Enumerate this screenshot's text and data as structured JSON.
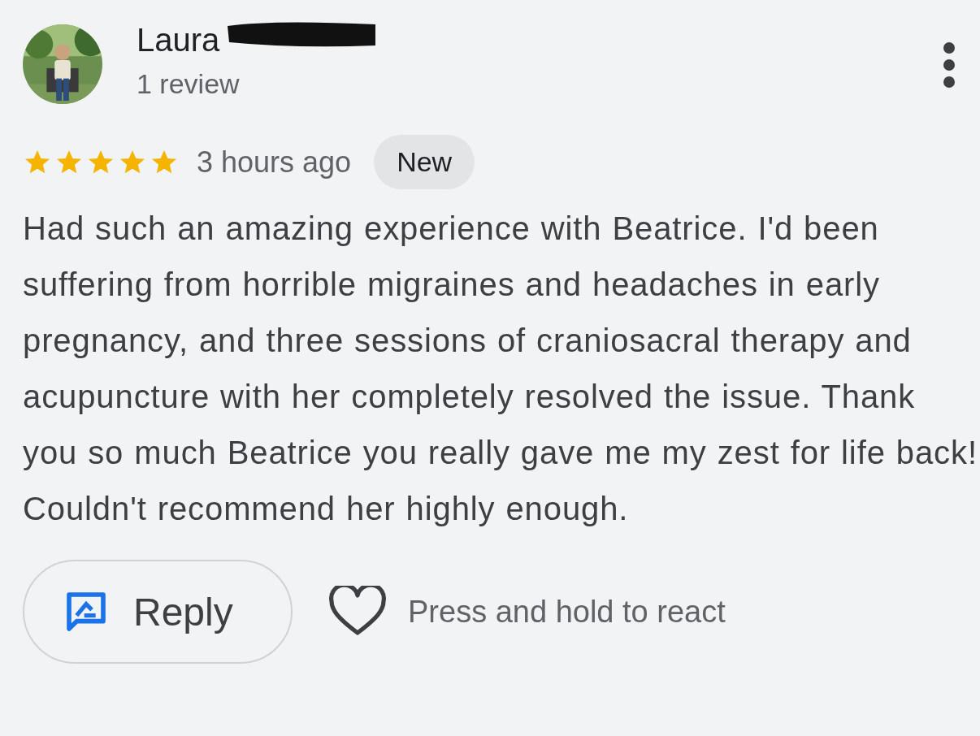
{
  "review": {
    "author": "Laura",
    "author_redacted": true,
    "review_count": "1 review",
    "stars": 5,
    "time": "3 hours ago",
    "badge": "New",
    "text": "Had such an amazing experience with Beatrice. I'd been suffering from horrible migraines and headaches in early pregnancy, and three sessions of craniosacral therapy and acupuncture with her completely resolved the issue. Thank you so much Beatrice you really gave me my zest for life back! Couldn't recommend her highly enough."
  },
  "actions": {
    "reply": "Reply",
    "react_hint": "Press and hold to react"
  }
}
